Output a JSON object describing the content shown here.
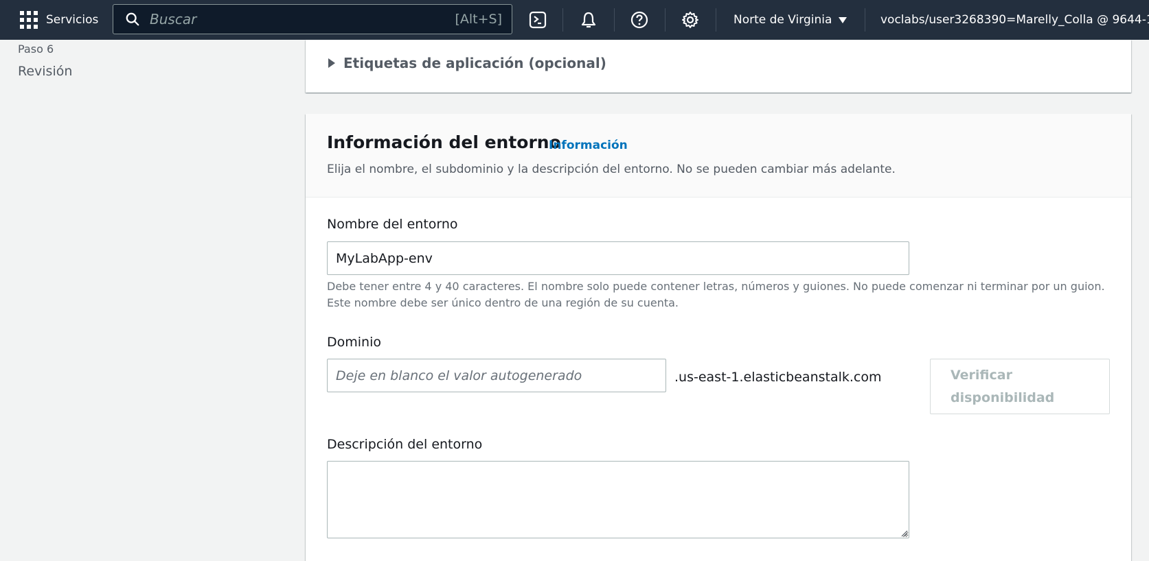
{
  "topnav": {
    "services_label": "Servicios",
    "search_placeholder": "Buscar",
    "search_shortcut": "[Alt+S]",
    "region": "Norte de Virginia",
    "user": "voclabs/user3268390=Marelly_Colla @ 9644-1("
  },
  "sidebar": {
    "step_label": "Paso 6",
    "step_title": "Revisión"
  },
  "tags_section": {
    "title": "Etiquetas de aplicación (opcional)"
  },
  "environment": {
    "title": "Información del entorno",
    "info_link": "Información",
    "description": "Elija el nombre, el subdominio y la descripción del entorno. No se pueden cambiar más adelante.",
    "name_label": "Nombre del entorno",
    "name_value": "MyLabApp-env",
    "name_hint_line1": "Debe tener entre 4 y 40 caracteres. El nombre solo puede contener letras, números y guiones. No puede comenzar ni terminar por un guion.",
    "name_hint_line2": "Este nombre debe ser único dentro de una región de su cuenta.",
    "domain_label": "Dominio",
    "domain_placeholder": "Deje en blanco el valor autogenerado",
    "domain_suffix": ".us-east-1.elasticbeanstalk.com",
    "verify_line1": "Verificar",
    "verify_line2": "disponibilidad",
    "env_desc_label": "Descripción del entorno",
    "env_desc_value": ""
  },
  "colors": {
    "nav_bg": "#232f3e",
    "link": "#0073bb",
    "page_bg": "#f2f3f3"
  }
}
